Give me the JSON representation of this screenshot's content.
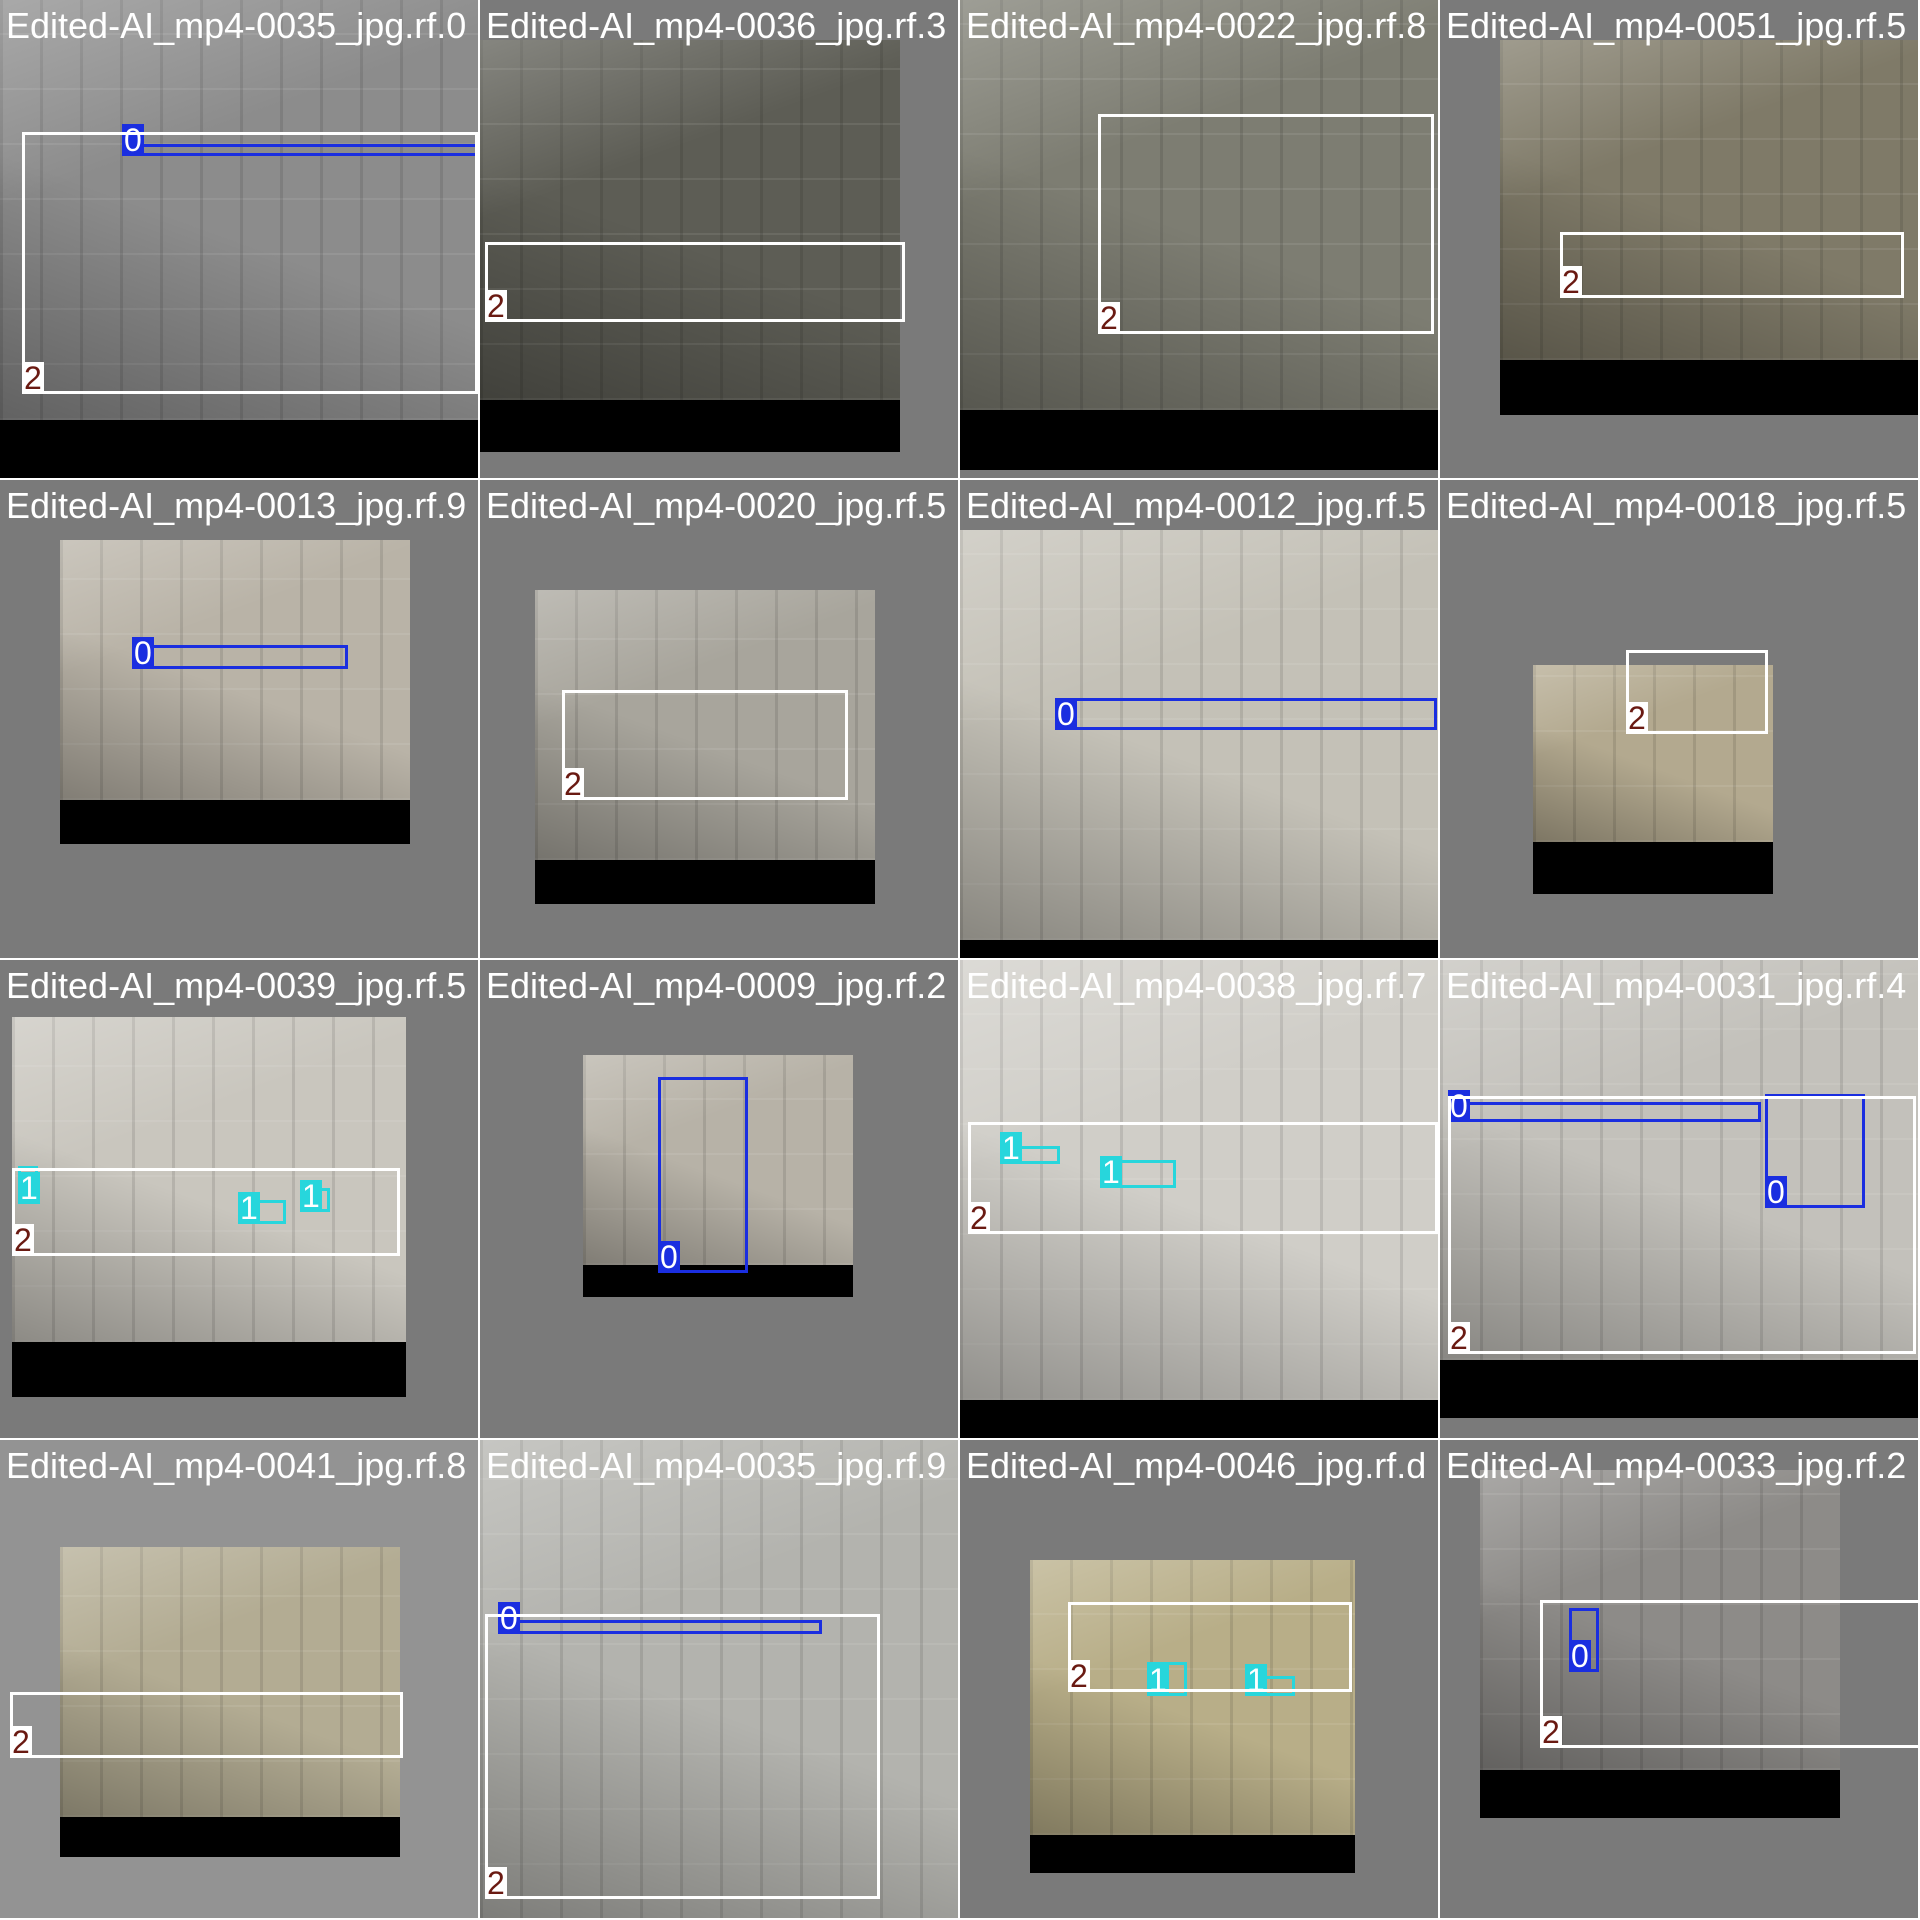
{
  "class_styles": {
    "0": {
      "stroke": "#1a2ee0",
      "label_bg": "#1a2ee0",
      "label_fg": "#ffffff"
    },
    "1": {
      "stroke": "#27d6dc",
      "label_bg": "#27d6dc",
      "label_fg": "#ffffff"
    },
    "2": {
      "stroke": "#ffffff",
      "label_bg": "#ffffff",
      "label_fg": "#6a1a12"
    }
  },
  "tiles": [
    {
      "filename": "Edited-AI_mp4-0035_jpg.rf.0",
      "overlap_text": "Edited-AI_mp4-0036_jpg.rf.3",
      "boxes": [
        {
          "label": "0"
        },
        {
          "label": "2"
        }
      ]
    },
    {
      "filename": "Edited-AI_mp4-0036_jpg.rf.3",
      "overlap_text": "Edited-AI_mp4-0022_jpg.rf.8",
      "boxes": [
        {
          "label": "2"
        }
      ]
    },
    {
      "filename": "Edited-AI_mp4-0022_jpg.rf.8",
      "overlap_text": "Edited-AI_mp4-0051_jpg.rf.5",
      "boxes": [
        {
          "label": "2"
        }
      ]
    },
    {
      "filename": "Edited-AI_mp4-0051_jpg.rf.5",
      "overlap_text": "",
      "boxes": [
        {
          "label": "2"
        }
      ]
    },
    {
      "filename": "Edited-AI_mp4-0013_jpg.rf.9",
      "overlap_text": "Edited-AI_mp4-0020_jpg.rf.5",
      "boxes": [
        {
          "label": "0"
        }
      ]
    },
    {
      "filename": "Edited-AI_mp4-0020_jpg.rf.5",
      "overlap_text": "Edited-AI_mp4-0012_jpg.rf.5",
      "boxes": [
        {
          "label": "2"
        }
      ]
    },
    {
      "filename": "Edited-AI_mp4-0012_jpg.rf.5",
      "overlap_text": "Edited-AI_mp4-0018_jpg.rf.5",
      "boxes": [
        {
          "label": "0"
        }
      ]
    },
    {
      "filename": "Edited-AI_mp4-0018_jpg.rf.5",
      "overlap_text": "",
      "boxes": [
        {
          "label": "2"
        }
      ]
    },
    {
      "filename": "Edited-AI_mp4-0039_jpg.rf.5",
      "overlap_text": "Edited-AI_mp4-0009_jpg.rf.2",
      "boxes": [
        {
          "label": "1"
        },
        {
          "label": "1"
        },
        {
          "label": "1"
        },
        {
          "label": "2"
        }
      ]
    },
    {
      "filename": "Edited-AI_mp4-0009_jpg.rf.2",
      "overlap_text": "Edited-AI_mp4-0038_jpg.rf.7",
      "boxes": [
        {
          "label": "0"
        }
      ]
    },
    {
      "filename": "Edited-AI_mp4-0038_jpg.rf.7",
      "overlap_text": "Edited-AI_mp4-0031_jpg.rf.4",
      "boxes": [
        {
          "label": "1"
        },
        {
          "label": "1"
        },
        {
          "label": "2"
        }
      ]
    },
    {
      "filename": "Edited-AI_mp4-0031_jpg.rf.4",
      "overlap_text": "",
      "boxes": [
        {
          "label": "0"
        },
        {
          "label": "0"
        },
        {
          "label": "2"
        }
      ]
    },
    {
      "filename": "Edited-AI_mp4-0041_jpg.rf.8",
      "overlap_text": "Edited-AI_mp4-0035_jpg.rf.9",
      "boxes": [
        {
          "label": "2"
        }
      ]
    },
    {
      "filename": "Edited-AI_mp4-0035_jpg.rf.9",
      "overlap_text": "Edited-AI_mp4-0046_jpg.rf.d",
      "boxes": [
        {
          "label": "0"
        },
        {
          "label": "2"
        }
      ]
    },
    {
      "filename": "Edited-AI_mp4-0046_jpg.rf.d",
      "overlap_text": "Edited-AI_mp4-0033_jpg.rf.2",
      "boxes": [
        {
          "label": "1"
        },
        {
          "label": "1"
        },
        {
          "label": "2"
        }
      ]
    },
    {
      "filename": "Edited-AI_mp4-0033_jpg.rf.2",
      "overlap_text": "",
      "boxes": [
        {
          "label": "0"
        },
        {
          "label": "2"
        }
      ]
    }
  ]
}
